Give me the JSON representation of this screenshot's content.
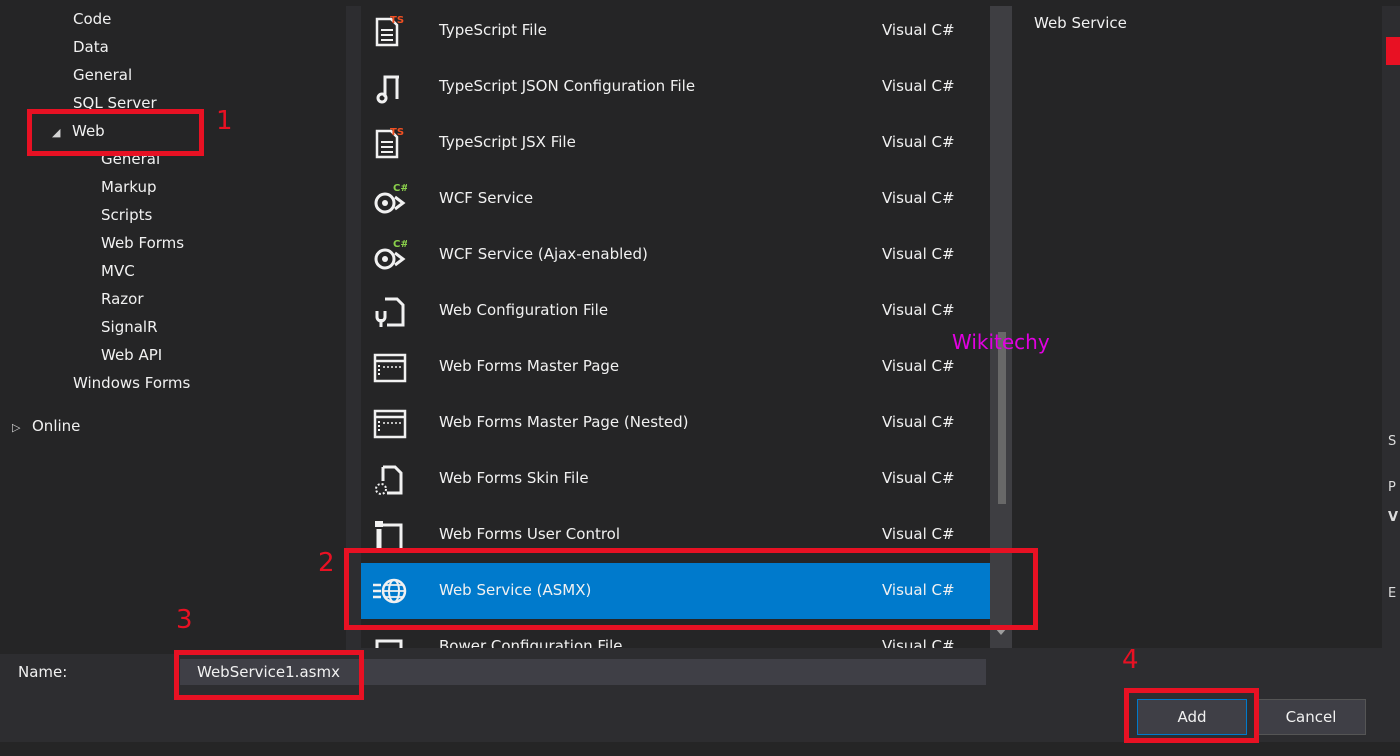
{
  "tree": {
    "items": [
      "Code",
      "Data",
      "General",
      "SQL Server",
      "Web",
      "General",
      "Markup",
      "Scripts",
      "Web Forms",
      "MVC",
      "Razor",
      "SignalR",
      "Web API",
      "Windows Forms",
      "Online"
    ]
  },
  "templates": [
    {
      "label": "TypeScript File",
      "lang": "Visual C#",
      "icon": "typescript-file-icon"
    },
    {
      "label": "TypeScript JSON Configuration File",
      "lang": "Visual C#",
      "icon": "json-config-icon"
    },
    {
      "label": "TypeScript JSX File",
      "lang": "Visual C#",
      "icon": "typescript-file-icon"
    },
    {
      "label": "WCF Service",
      "lang": "Visual C#",
      "icon": "wcf-service-icon"
    },
    {
      "label": "WCF Service (Ajax-enabled)",
      "lang": "Visual C#",
      "icon": "wcf-service-icon"
    },
    {
      "label": "Web Configuration File",
      "lang": "Visual C#",
      "icon": "web-config-icon"
    },
    {
      "label": "Web Forms Master Page",
      "lang": "Visual C#",
      "icon": "master-page-icon"
    },
    {
      "label": "Web Forms Master Page (Nested)",
      "lang": "Visual C#",
      "icon": "master-page-icon"
    },
    {
      "label": "Web Forms Skin File",
      "lang": "Visual C#",
      "icon": "skin-file-icon"
    },
    {
      "label": "Web Forms User Control",
      "lang": "Visual C#",
      "icon": "user-control-icon"
    },
    {
      "label": "Web Service (ASMX)",
      "lang": "Visual C#",
      "icon": "globe-service-icon",
      "selected": true
    },
    {
      "label": "Bower Configuration File",
      "lang": "Visual C#",
      "icon": "bower-config-icon"
    }
  ],
  "description": "Web Service",
  "name_label": "Name:",
  "name_value": "WebService1.asmx",
  "add_label": "Add",
  "cancel_label": "Cancel",
  "watermark": "Wikitechy",
  "annotations": [
    "1",
    "2",
    "3",
    "4"
  ],
  "edge_fragments": [
    "S",
    "P",
    "V",
    "E"
  ],
  "colors": {
    "selected": "#007acc",
    "annotation": "#e81123",
    "watermark": "#e100e1"
  }
}
